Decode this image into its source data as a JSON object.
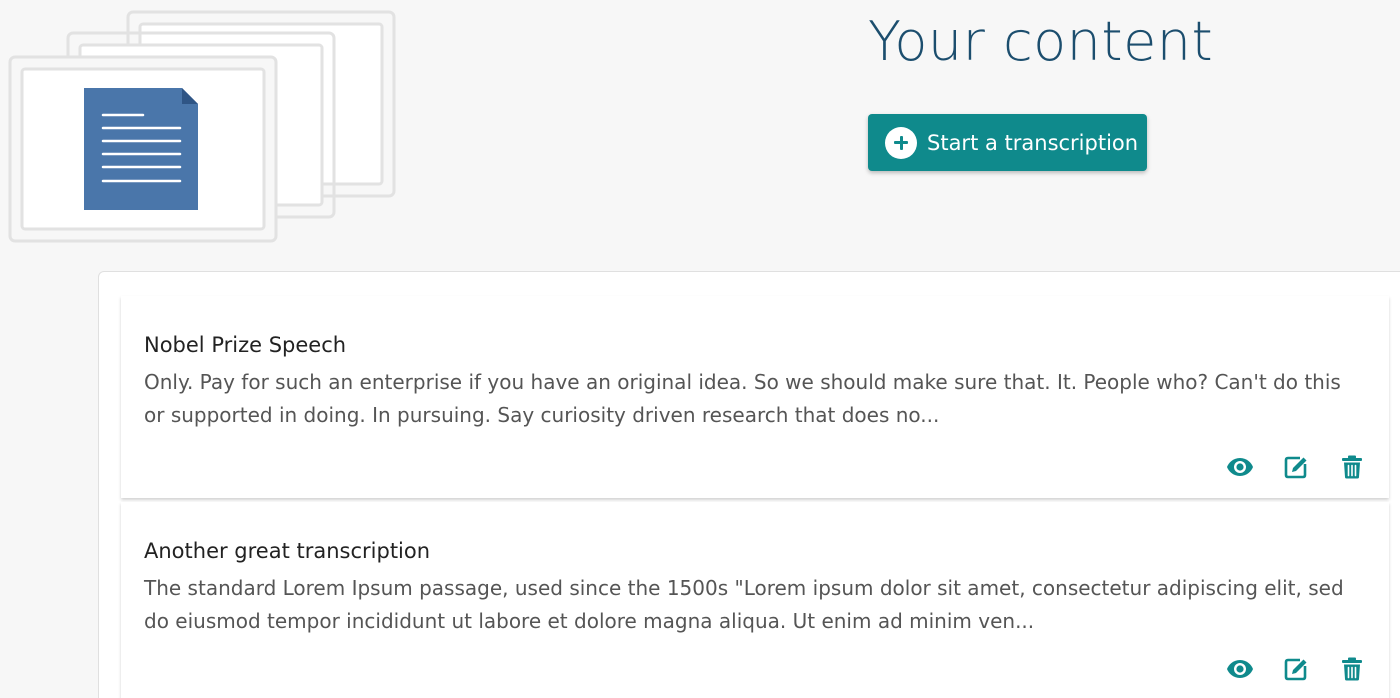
{
  "header": {
    "title": "Your content",
    "cta_label": "Start a transcription"
  },
  "transcriptions": [
    {
      "title": "Nobel Prize Speech",
      "excerpt": "Only. Pay for such an enterprise if you have an original idea. So we should make sure that. It. People who? Can't do this or supported in doing. In pursuing. Say curiosity driven research that does no..."
    },
    {
      "title": "Another great transcription",
      "excerpt": "The standard Lorem Ipsum passage, used since the 1500s \"Lorem ipsum dolor sit amet, consectetur adipiscing elit, sed do eiusmod tempor incididunt ut labore et dolore magna aliqua. Ut enim ad minim ven..."
    }
  ],
  "icons": {
    "cta": "plus-circle-icon",
    "view": "eye-icon",
    "edit": "edit-icon",
    "delete": "trash-icon",
    "illustration": "document-stack-icon"
  },
  "colors": {
    "accent": "#0f8a8c",
    "title": "#1c4e6e",
    "document": "#4a76aa",
    "background": "#f7f7f7"
  }
}
